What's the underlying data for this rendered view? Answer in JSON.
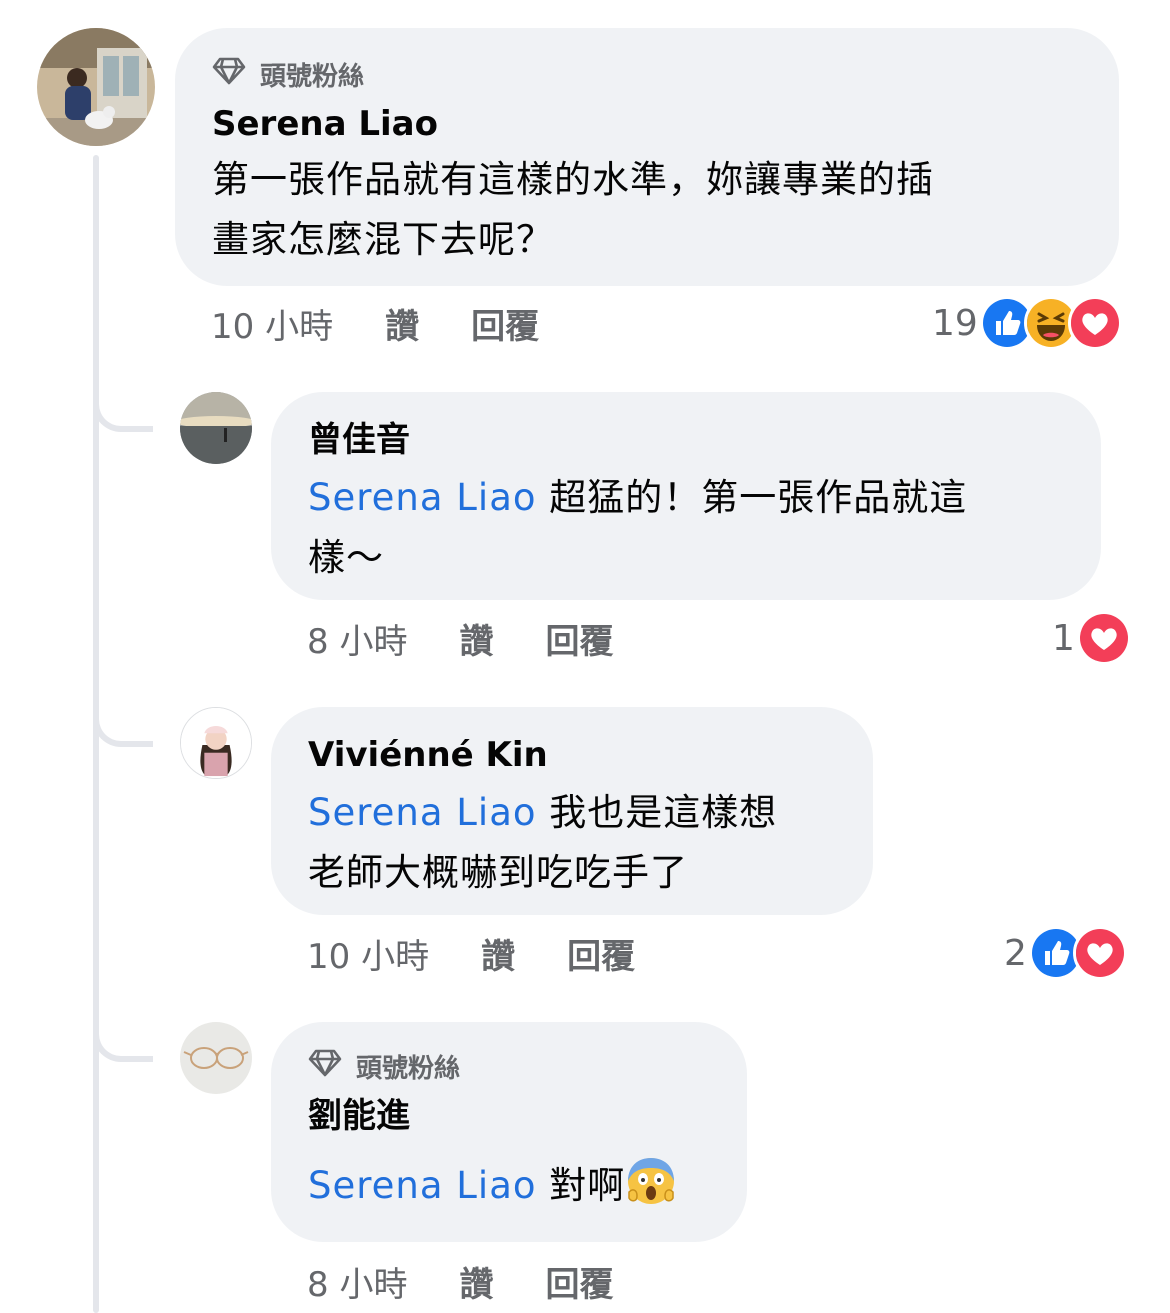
{
  "badge_label": "頭號粉絲",
  "comments": [
    {
      "author": "Serena Liao",
      "text_line1": "第一張作品就有這樣的水準，妳讓專業的插",
      "text_line2": "畫家怎麼混下去呢？",
      "time": "10 小時",
      "like_label": "讚",
      "reply_label": "回覆",
      "reaction_count": "19",
      "reactions": [
        "like-icon",
        "haha-icon",
        "love-icon"
      ]
    },
    {
      "author": "曾佳音",
      "mention": "Serena Liao",
      "text_line1": " 超猛的！第一張作品就這",
      "text_line2": "樣～",
      "time": "8 小時",
      "like_label": "讚",
      "reply_label": "回覆",
      "reaction_count": "1",
      "reactions": [
        "love-icon"
      ]
    },
    {
      "author": "Viviénné Kin",
      "mention": "Serena Liao",
      "text_line1": " 我也是這樣想",
      "text_line2": "老師大概嚇到吃吃手了",
      "time": "10 小時",
      "like_label": "讚",
      "reply_label": "回覆",
      "reaction_count": "2",
      "reactions": [
        "like-icon",
        "love-icon"
      ]
    },
    {
      "author": "劉能進",
      "mention": "Serena Liao",
      "text_line1": " 對啊",
      "inline_emoji": "scream-emoji",
      "time": "8 小時",
      "like_label": "讚",
      "reply_label": "回覆"
    }
  ],
  "colors": {
    "bubble": "#f0f2f5",
    "mention": "#216fdb",
    "meta": "#65676b",
    "like": "#1877f2",
    "love": "#f33e58",
    "thread_line": "#e4e6eb"
  }
}
